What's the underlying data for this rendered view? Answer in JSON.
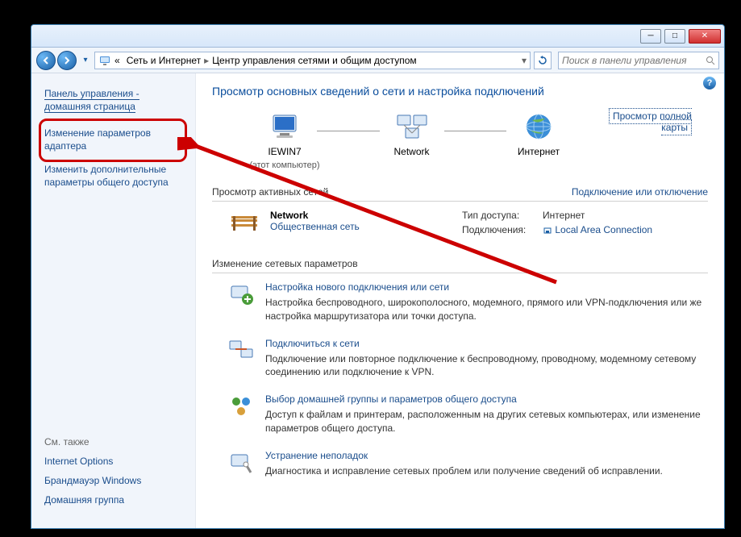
{
  "breadcrumb": {
    "sep": "«",
    "seg1": "Сеть и Интернет",
    "seg2": "Центр управления сетями и общим доступом"
  },
  "search": {
    "placeholder": "Поиск в панели управления"
  },
  "sidebar": {
    "cp_home_l1": "Панель управления -",
    "cp_home_l2": "домашняя страница",
    "link_adapter_l1": "Изменение параметров",
    "link_adapter_l2": "адаптера",
    "link_sharing_l1": "Изменить дополнительные",
    "link_sharing_l2": "параметры общего доступа",
    "see_also": "См. также",
    "internet_options": "Internet Options",
    "firewall": "Брандмауэр Windows",
    "homegroup": "Домашняя группа"
  },
  "main": {
    "heading": "Просмотр основных сведений о сети и настройка подключений",
    "map_link": "Просмотр полной карты",
    "node1": {
      "label": "IEWIN7",
      "sub": "(этот компьютер)"
    },
    "node2": {
      "label": "Network"
    },
    "node3": {
      "label": "Интернет"
    },
    "section_active": "Просмотр активных сетей",
    "connect_action": "Подключение или отключение",
    "network": {
      "name": "Network",
      "type": "Общественная сеть",
      "access_k": "Тип доступа:",
      "access_v": "Интернет",
      "conn_k": "Подключения:",
      "conn_v": "Local Area Connection"
    },
    "section_settings": "Изменение сетевых параметров",
    "items": [
      {
        "title": "Настройка нового подключения или сети",
        "desc": "Настройка беспроводного, широкополосного, модемного, прямого или VPN-подключения или же настройка маршрутизатора или точки доступа."
      },
      {
        "title": "Подключиться к сети",
        "desc": "Подключение или повторное подключение к беспроводному, проводному, модемному сетевому соединению или подключение к VPN."
      },
      {
        "title": "Выбор домашней группы и параметров общего доступа",
        "desc": "Доступ к файлам и принтерам, расположенным на других сетевых компьютерах, или изменение параметров общего доступа."
      },
      {
        "title": "Устранение неполадок",
        "desc": "Диагностика и исправление сетевых проблем или получение сведений об исправлении."
      }
    ]
  }
}
